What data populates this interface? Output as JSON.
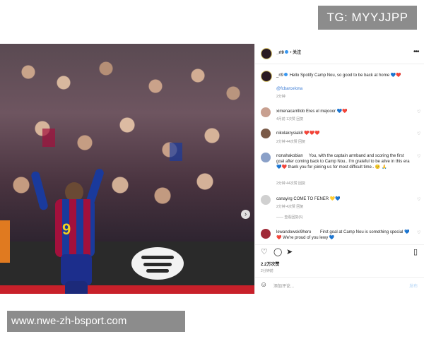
{
  "watermark_top": "TG: MYYJJPP",
  "watermark_bottom": "www.nwe-zh-bsport.com",
  "photo": {
    "ad_text": "IV O",
    "carousel_dots": 5,
    "active_dot": 1
  },
  "post": {
    "username": "_rl9",
    "follow": "关注",
    "caption_user": "_rl9",
    "caption_text": "Hello Spotify Camp Nou, so good to be back at home 💙❤️",
    "tag": "@fcbarcelona",
    "caption_time": "2分钟"
  },
  "comments": [
    {
      "user": "ximenacarrillob",
      "text": "Eres el mejooor 💙❤️",
      "meta": "4月前  1次赞  回复"
    },
    {
      "user": "nikolakrysiak8",
      "text": "❤️❤️❤️",
      "meta": "2分钟  44次赞  回复"
    },
    {
      "user": "nonahakobian",
      "text": "You, with the captain armband and scoring the first goal after coming back to Camp Nou.. I'm grateful to be alive in this era 💙❤️ thank you for joining us for most difficult time.. 🙂 🙏",
      "meta": "2分钟  44次赞  回复"
    },
    {
      "user": "canayirg",
      "text": "COME TO FENER 💛💙",
      "meta": "2分钟  4次赞  回复"
    },
    {
      "user": "",
      "text": "",
      "meta": "—— 查看回复(6)"
    },
    {
      "user": "lewandowski9hero",
      "text": "First goal at Camp Nou is something special 💙❤️ We're proud of you lewy 💙",
      "meta": ""
    }
  ],
  "actions": {
    "likes": "2.2万次赞",
    "time": "2分钟前",
    "comment_placeholder": "添加评论...",
    "post_button": "发布"
  }
}
